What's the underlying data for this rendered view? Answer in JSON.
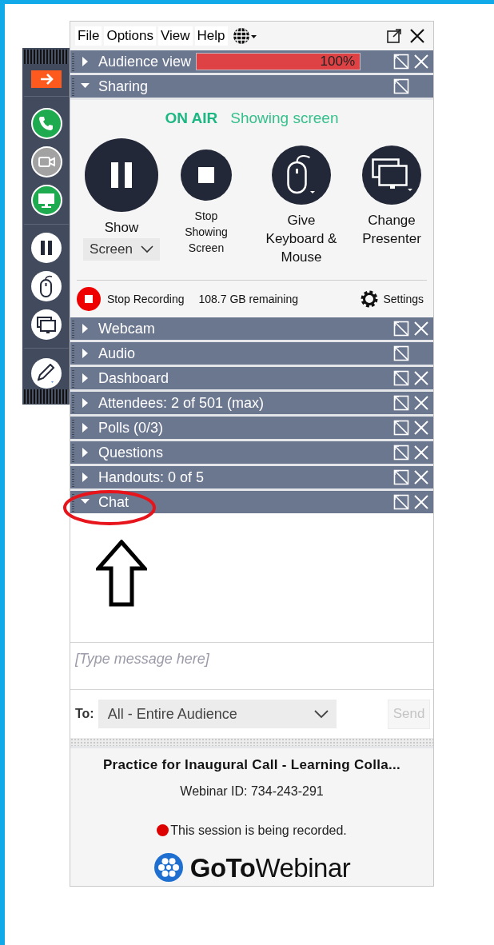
{
  "menu": [
    "File",
    "Options",
    "View",
    "Help"
  ],
  "toolbar": [
    {
      "kind": "phone",
      "on": true
    },
    {
      "kind": "webcam",
      "on": false
    },
    {
      "kind": "screen",
      "on": true
    }
  ],
  "panels": [
    {
      "title": "Audience view",
      "kind": "progress",
      "expanded": false,
      "closable": true,
      "level": 1,
      "reading": "100%"
    },
    {
      "title": "Sharing",
      "kind": "sharing",
      "expanded": true,
      "closable": false
    },
    {
      "title": "Webcam",
      "kind": "plain",
      "expanded": false,
      "closable": true
    },
    {
      "title": "Audio",
      "kind": "plain",
      "expanded": false,
      "closable": false
    },
    {
      "title": "Dashboard",
      "kind": "plain",
      "expanded": false,
      "closable": true
    },
    {
      "title": "Attendees:  2 of 501 (max)",
      "kind": "plain",
      "expanded": false,
      "closable": true
    },
    {
      "title": "Polls (0/3)",
      "kind": "plain",
      "expanded": false,
      "closable": true
    },
    {
      "title": "Questions",
      "kind": "plain",
      "expanded": false,
      "closable": true
    },
    {
      "title": "Handouts: 0 of 5",
      "kind": "plain",
      "expanded": false,
      "closable": true
    },
    {
      "title": "Chat",
      "kind": "chat",
      "expanded": true,
      "closable": true
    }
  ],
  "sharing": {
    "status": "ON AIR",
    "detail": "Showing screen",
    "actions": [
      {
        "kind": "pause",
        "label": "Show",
        "dropdown": "Screen"
      },
      {
        "kind": "stop",
        "label": "Stop Showing Screen"
      },
      {
        "kind": "mouse",
        "label": "Give Keyboard & Mouse"
      },
      {
        "kind": "monitors",
        "label": "Change Presenter"
      }
    ],
    "recording": "Stop Recording",
    "remaining": "108.7 GB remaining",
    "settings": "Settings"
  },
  "chat": {
    "placeholder": "[Type message here]",
    "to_label": "To:",
    "recipient": "All - Entire Audience",
    "send": "Send",
    "send_disabled": true
  },
  "footer": {
    "title": "Practice for Inaugural Call - Learning Colla...",
    "webinar_id": "Webinar ID: 734-243-291",
    "recording_notice": "This session is being recorded.",
    "brand": "**GoTo**Webinar"
  }
}
